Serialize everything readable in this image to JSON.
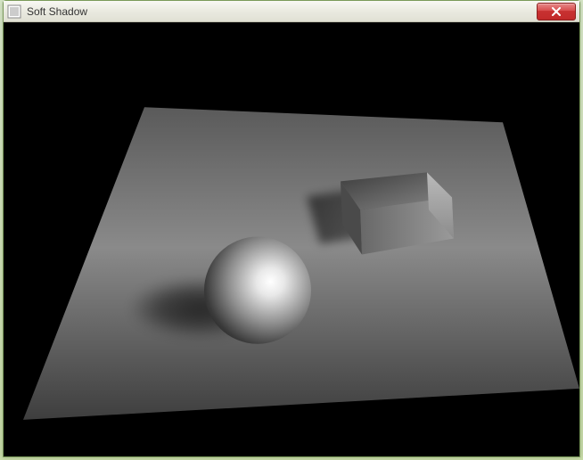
{
  "window": {
    "title": "Soft Shadow",
    "icon_name": "app-icon"
  },
  "controls": {
    "close_label": "Close"
  },
  "scene": {
    "description": "3D render of a sphere and a cube on a gray plane with soft shadows",
    "background_color": "#000000",
    "plane_color": "#7a7a7a",
    "objects": [
      "sphere",
      "cube"
    ],
    "light_direction": "upper-right"
  }
}
